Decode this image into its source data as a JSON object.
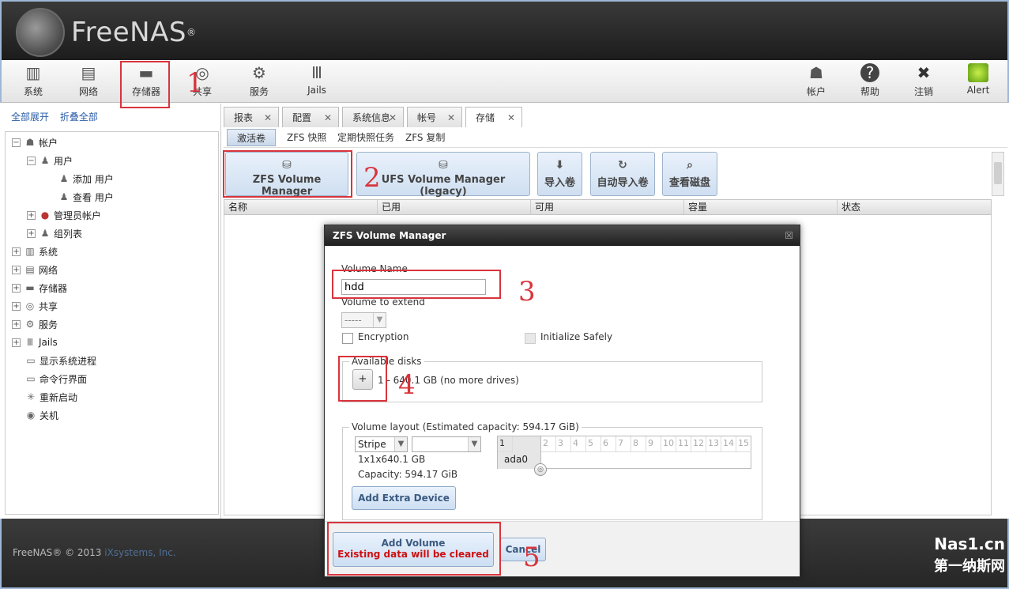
{
  "app": {
    "logo_text": "FreeNAS",
    "logo_reg": "®"
  },
  "toolbar": {
    "left": [
      {
        "label": "系统",
        "icon": "system-icon"
      },
      {
        "label": "网络",
        "icon": "network-icon"
      },
      {
        "label": "存储器",
        "icon": "storage-icon"
      },
      {
        "label": "共享",
        "icon": "sharing-icon"
      },
      {
        "label": "服务",
        "icon": "services-icon"
      },
      {
        "label": "Jails",
        "icon": "jails-icon"
      }
    ],
    "right": [
      {
        "label": "帐户",
        "icon": "account-icon"
      },
      {
        "label": "帮助",
        "icon": "help-icon"
      },
      {
        "label": "注销",
        "icon": "logout-icon"
      },
      {
        "label": "Alert",
        "icon": "alert-icon"
      }
    ]
  },
  "sidebar": {
    "expand_all": "全部展开",
    "collapse_all": "折叠全部",
    "tree": [
      {
        "label": "帐户",
        "exp": "−",
        "icon": "account-icon"
      },
      {
        "label": "用户",
        "exp": "−",
        "icon": "user-icon"
      },
      {
        "label": "添加 用户",
        "exp": "",
        "icon": "add-user-icon"
      },
      {
        "label": "查看 用户",
        "exp": "",
        "icon": "view-users-icon"
      },
      {
        "label": "管理员帐户",
        "exp": "+",
        "icon": "admin-icon"
      },
      {
        "label": "组列表",
        "exp": "+",
        "icon": "group-icon"
      },
      {
        "label": "系统",
        "exp": "+",
        "icon": "system-icon"
      },
      {
        "label": "网络",
        "exp": "+",
        "icon": "network-icon"
      },
      {
        "label": "存储器",
        "exp": "+",
        "icon": "storage-icon"
      },
      {
        "label": "共享",
        "exp": "+",
        "icon": "sharing-icon"
      },
      {
        "label": "服务",
        "exp": "+",
        "icon": "services-icon"
      },
      {
        "label": "Jails",
        "exp": "+",
        "icon": "jails-icon"
      },
      {
        "label": "显示系统进程",
        "exp": "",
        "icon": "processes-icon"
      },
      {
        "label": "命令行界面",
        "exp": "",
        "icon": "shell-icon"
      },
      {
        "label": "重新启动",
        "exp": "",
        "icon": "reboot-icon"
      },
      {
        "label": "关机",
        "exp": "",
        "icon": "shutdown-icon"
      }
    ]
  },
  "tabs": [
    {
      "label": "报表",
      "close": "✕"
    },
    {
      "label": "配置",
      "close": "✕"
    },
    {
      "label": "系统信息",
      "close": "✕"
    },
    {
      "label": "帐号",
      "close": "✕"
    },
    {
      "label": "存储",
      "close": "✕"
    }
  ],
  "subtabs": [
    "激活卷",
    "ZFS 快照",
    "定期快照任务",
    "ZFS 复制"
  ],
  "actions": [
    {
      "label": "ZFS Volume Manager",
      "icon": "volume-add-icon"
    },
    {
      "label": "UFS Volume Manager (legacy)",
      "icon": "volume-add-icon"
    },
    {
      "label": "导入卷",
      "icon": "import-icon"
    },
    {
      "label": "自动导入卷",
      "icon": "auto-import-icon"
    },
    {
      "label": "查看磁盘",
      "icon": "view-disks-icon"
    }
  ],
  "grid": {
    "columns": [
      "名称",
      "已用",
      "可用",
      "容量",
      "状态"
    ]
  },
  "dialog": {
    "title": "ZFS Volume Manager",
    "close": "☒",
    "volume_name_label": "Volume Name",
    "volume_name_value": "hdd",
    "extend_label": "Volume to extend",
    "extend_value": "-----",
    "encryption_label": "Encryption",
    "init_safely_label": "Initialize Safely",
    "available_legend": "Available disks",
    "plus_label": "+",
    "available_text": "1 - 640.1 GB (no more drives)",
    "layout_legend": "Volume layout (Estimated capacity: 594.17 GiB)",
    "layout_type": "Stripe",
    "layout_second": "",
    "layout_size": "1x1x640.1 GB",
    "layout_capacity": "Capacity: 594.17 GiB",
    "disk_grid_numbers": [
      "1",
      "2",
      "3",
      "4",
      "5",
      "6",
      "7",
      "8",
      "9",
      "10",
      "11",
      "12",
      "13",
      "14",
      "15"
    ],
    "disk_name": "ada0",
    "add_extra_label": "Add Extra Device",
    "add_volume_label": "Add Volume",
    "add_volume_warning": "Existing data will be cleared",
    "cancel_label": "Cancel"
  },
  "footer": {
    "copyright": "FreeNAS® © 2013 ",
    "company": "iXsystems, Inc.",
    "watermark_top": "Nas1.cn",
    "watermark_bottom": "第一纳斯网"
  },
  "annotations": [
    "1",
    "2",
    "3",
    "4",
    "5"
  ],
  "colors": {
    "annotation": "#d9343c",
    "link": "#2a5da8",
    "warning": "#cc1111"
  }
}
